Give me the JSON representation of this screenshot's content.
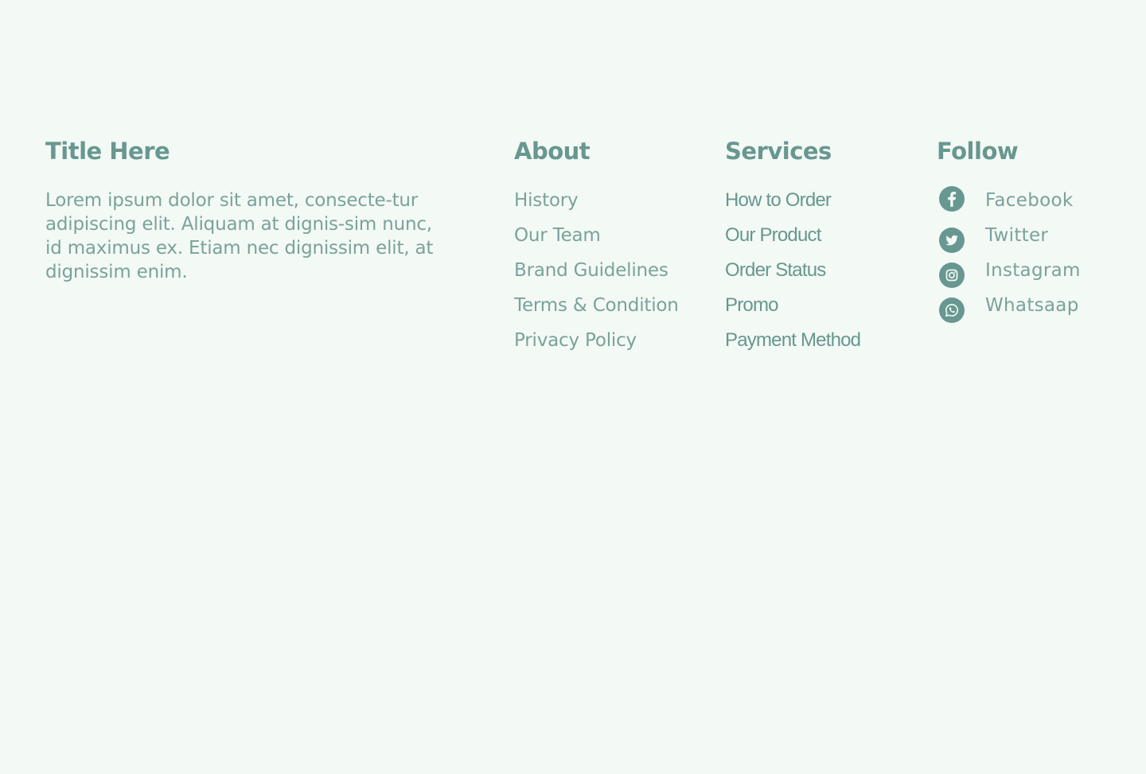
{
  "brand": {
    "title": "Title Here",
    "text": "Lorem ipsum dolor sit amet, consecte-tur adipiscing elit. Aliquam at dignis-sim nunc, id maximus ex. Etiam nec dignissim elit, at dignissim enim."
  },
  "about": {
    "title": "About",
    "links": [
      "History",
      "Our Team",
      "Brand Guidelines",
      "Terms & Condition",
      "Privacy Policy"
    ]
  },
  "services": {
    "title": "Services",
    "links": [
      "How to Order",
      "Our Product",
      "Order Status",
      "Promo",
      "Payment Method"
    ]
  },
  "follow": {
    "title": "Follow",
    "links": [
      {
        "label": "Facebook",
        "icon": "facebook-icon"
      },
      {
        "label": "Twitter",
        "icon": "twitter-icon"
      },
      {
        "label": "Instagram",
        "icon": "instagram-icon"
      },
      {
        "label": "Whatsaap",
        "icon": "whatsapp-icon"
      }
    ]
  },
  "colors": {
    "background": "#f3f9f4",
    "accent": "#679790",
    "text": "#7aa29c"
  }
}
